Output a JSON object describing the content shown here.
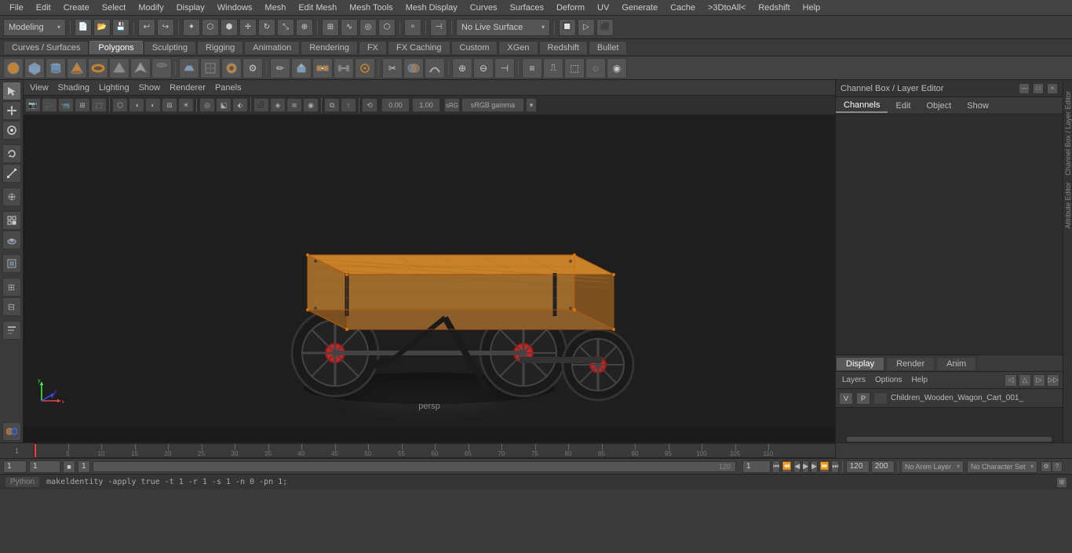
{
  "menu": {
    "items": [
      "File",
      "Edit",
      "Create",
      "Select",
      "Modify",
      "Display",
      "Windows",
      "Mesh",
      "Edit Mesh",
      "Mesh Tools",
      "Mesh Display",
      "Curves",
      "Surfaces",
      "Deform",
      "UV",
      "Generate",
      "Cache",
      ">3DtoAll<",
      "Redshift",
      "Help"
    ]
  },
  "toolbar": {
    "mode_dropdown": "Modeling",
    "live_surface": "No Live Surface"
  },
  "mode_tabs": {
    "tabs": [
      "Curves / Surfaces",
      "Polygons",
      "Sculpting",
      "Rigging",
      "Animation",
      "Rendering",
      "FX",
      "FX Caching",
      "Custom",
      "XGen",
      "Redshift",
      "Bullet"
    ],
    "active": "Polygons"
  },
  "viewport": {
    "menus": [
      "View",
      "Shading",
      "Lighting",
      "Show",
      "Renderer",
      "Panels"
    ],
    "label": "persp",
    "gamma": "sRGB gamma"
  },
  "channel_box": {
    "title": "Channel Box / Layer Editor",
    "tabs": [
      "Channels",
      "Edit",
      "Object",
      "Show"
    ]
  },
  "display_tabs": {
    "tabs": [
      "Display",
      "Render",
      "Anim"
    ],
    "active": "Display"
  },
  "layers_panel": {
    "title": "Layers",
    "menu_items": [
      "Layers",
      "Options",
      "Help"
    ],
    "layer": {
      "v": "V",
      "p": "P",
      "name": "Children_Wooden_Wagon_Cart_001_"
    }
  },
  "timeline": {
    "current_frame": "1",
    "start_frame": "1",
    "end_frame": "120",
    "range_start": "1",
    "range_end": "120",
    "max_frame": "200",
    "ticks": [
      5,
      10,
      15,
      20,
      25,
      30,
      35,
      40,
      45,
      50,
      55,
      60,
      65,
      70,
      75,
      80,
      85,
      90,
      95,
      100,
      105,
      110
    ]
  },
  "playback": {
    "current": "1",
    "buttons": [
      "⏮",
      "⏪",
      "◀",
      "▶",
      "⏩",
      "⏭"
    ]
  },
  "anim_layer": "No Anim Layer",
  "char_set": "No Character Set",
  "python": {
    "label": "Python",
    "command": "makeldentity -apply true -t 1 -r 1 -s 1 -n 0 -pn 1;"
  },
  "status_fields": {
    "frame1": "1",
    "frame2": "1",
    "field1": "1",
    "range_end": "120",
    "max": "200"
  },
  "icons": {
    "arrow_left": "◂",
    "arrow_right": "▸",
    "arrow_up": "▴",
    "arrow_down": "▾",
    "play": "▶",
    "pause": "⏸",
    "stop": "■",
    "rewind": "◀◀",
    "forward": "▶▶",
    "first": "⏮",
    "last": "⏭",
    "gear": "⚙",
    "grid": "⊞",
    "camera": "📷",
    "eye": "👁",
    "lock": "🔒",
    "magnet": "⚡",
    "select": "✦",
    "move": "✛",
    "rotate": "↻",
    "scale": "⤡",
    "close": "×",
    "expand": "⤢"
  },
  "vertical_labels": [
    "Channel Box / Layer Editor",
    "Attribute Editor"
  ]
}
